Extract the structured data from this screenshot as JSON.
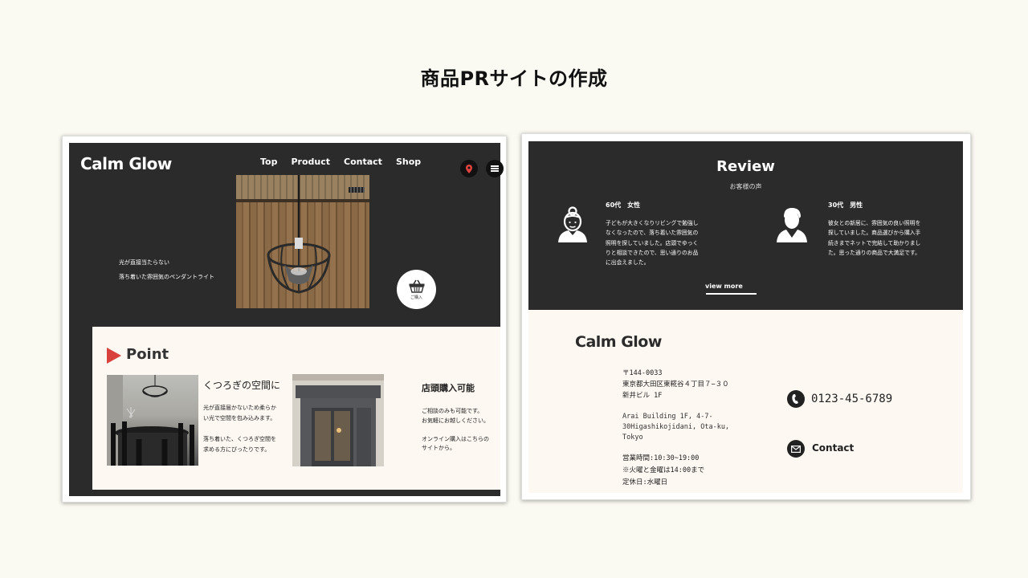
{
  "page_title": "商品PRサイトの作成",
  "left_mockup": {
    "brand": "Calm Glow",
    "nav": [
      "Top",
      "Product",
      "Contact",
      "Shop"
    ],
    "hero_lines": [
      "光が直接当たらない",
      "落ち着いた雰囲気のペンダントライト"
    ],
    "cart_label": "ご購入",
    "point_title": "Point",
    "features": [
      {
        "title": "くつろぎの空間に",
        "text": "光が直接届かないため柔らか\nい光で空間を包み込みます。\n\n落ち着いた、くつろぎ空間を\n求める方にぴったりです。"
      },
      {
        "title": "店頭購入可能",
        "text": "ご相談のみも可能です。\nお気軽にお越しください。\n\nオンライン購入はこちらの\nサイトから。"
      }
    ],
    "accent_color": "#d9413d"
  },
  "right_mockup": {
    "review_title": "Review",
    "review_subtitle": "お客様の声",
    "reviews": [
      {
        "heading": "60代　女性",
        "text": "子どもが大きくなりリビングで勉強し\nなくなったので、落ち着いた雰囲気の\n照明を探していました。店頭でゆっく\nりと相談できたので、思い通りのお品\nに出会えました。"
      },
      {
        "heading": "30代　男性",
        "text": "彼女との新居に、雰囲気の良い照明を\n探していました。商品選びから購入手\n続きまでネットで完結して助かりまし\nた。思った通りの商品で大満足です。"
      }
    ],
    "view_more": "view more",
    "brand": "Calm Glow",
    "address_jp": "〒144-0033\n東京都大田区東糀谷４丁目７−３０\n新井ビル 1F",
    "address_en": "Arai Building 1F, 4-7-\n30Higashikojidani, Ota-ku,\nTokyo",
    "hours": "営業時間:10:30~19:00\n※火曜と金曜は14:00まで\n定休日:水曜日",
    "phone": "0123-45-6789",
    "contact": "Contact"
  }
}
